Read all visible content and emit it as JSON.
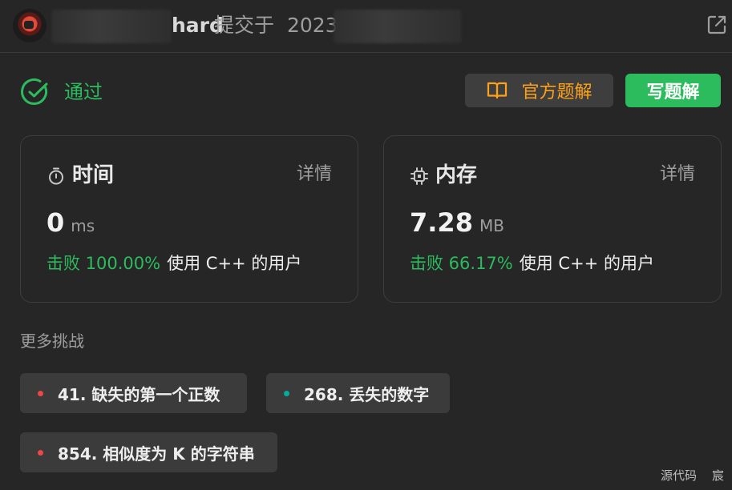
{
  "header": {
    "author_visible": "hard",
    "submitted_label": "提交于",
    "year_visible": "2023"
  },
  "status": {
    "label": "通过",
    "color": "#2cbb5d"
  },
  "buttons": {
    "official_solution": "官方题解",
    "write_solution": "写题解"
  },
  "cards": {
    "time": {
      "title": "时间",
      "detail": "详情",
      "value": "0",
      "unit": "ms",
      "beats": "击败 100.00%",
      "beats_suffix": "使用 C++ 的用户"
    },
    "memory": {
      "title": "内存",
      "detail": "详情",
      "value": "7.28",
      "unit": "MB",
      "beats": "击败 66.17%",
      "beats_suffix": "使用 C++ 的用户"
    }
  },
  "more": {
    "title": "更多挑战",
    "challenges": [
      {
        "label": "41. 缺失的第一个正数",
        "difficulty_color": "#ef4743"
      },
      {
        "label": "268. 丢失的数字",
        "difficulty_color": "#00af9b"
      },
      {
        "label": "854. 相似度为 K 的字符串",
        "difficulty_color": "#ef4743"
      }
    ]
  },
  "footer": {
    "source_label": "源代码",
    "extra_label": "宸"
  },
  "icons": {
    "external_link": "external-link-icon",
    "status": "check-circle-icon",
    "book": "book-icon",
    "timer": "timer-icon",
    "chip": "chip-icon"
  }
}
